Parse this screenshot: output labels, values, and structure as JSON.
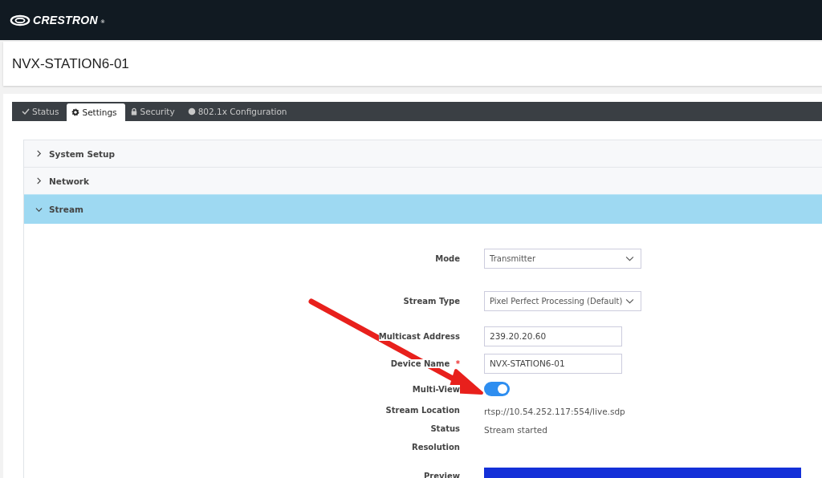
{
  "header": {
    "brand": "CRESTRON",
    "brand_mark": "®"
  },
  "device_title": "NVX-STATION6-01",
  "tabs": [
    {
      "label": "Status",
      "selected": false
    },
    {
      "label": "Settings",
      "selected": true
    },
    {
      "label": "Security",
      "selected": false
    },
    {
      "label": "802.1x Configuration",
      "selected": false
    }
  ],
  "sections": [
    {
      "label": "System Setup",
      "expanded": false
    },
    {
      "label": "Network",
      "expanded": false
    },
    {
      "label": "Stream",
      "expanded": true
    }
  ],
  "stream_fields": [
    {
      "kind": "select",
      "label": "Mode",
      "value": "Transmitter"
    },
    {
      "kind": "select",
      "label": "Stream Type",
      "value": "Pixel Perfect Processing (Default)"
    },
    {
      "kind": "input",
      "label": "Multicast Address",
      "value": "239.20.20.60"
    },
    {
      "kind": "input",
      "label": "Device Name",
      "required_mark": "*",
      "value": "NVX-STATION6-01"
    },
    {
      "kind": "toggle",
      "label": "Multi-View",
      "on": true
    },
    {
      "kind": "text",
      "label": "Stream Location",
      "value": "rtsp://10.54.252.117:554/live.sdp"
    },
    {
      "kind": "text",
      "label": "Status",
      "value": "Stream started"
    },
    {
      "kind": "text",
      "label": "Resolution"
    },
    {
      "kind": "preview",
      "label": "Preview"
    }
  ],
  "annotation": {
    "kind": "arrow"
  }
}
